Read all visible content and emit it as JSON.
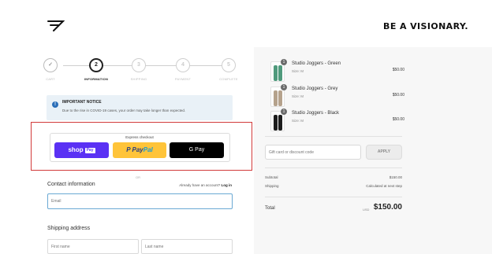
{
  "brand": {
    "logo_icon": "gymshark-logo-icon",
    "tagline": "BE A VISIONARY."
  },
  "progress": {
    "steps": [
      {
        "number": "✓",
        "label": "CART",
        "state": "done"
      },
      {
        "number": "2",
        "label": "INFORMATION",
        "state": "active"
      },
      {
        "number": "3",
        "label": "SHIPPING",
        "state": "pending"
      },
      {
        "number": "4",
        "label": "PAYMENT",
        "state": "pending"
      },
      {
        "number": "5",
        "label": "COMPLETE",
        "state": "pending"
      }
    ]
  },
  "notice": {
    "icon": "info-icon",
    "title": "IMPORTANT NOTICE",
    "text": "Due to the rise in COVID-19 cases, your order may take longer than expected."
  },
  "express": {
    "title": "Express checkout",
    "shop_pay": {
      "label": "shop",
      "badge": "Pay"
    },
    "paypal": {
      "pay": "P Pay",
      "pal": "Pal"
    },
    "gpay": {
      "label": "G Pay"
    }
  },
  "divider_or": "OR",
  "contact": {
    "title": "Contact information",
    "have_account": "Already have an account?",
    "login": "Log in",
    "email_placeholder": "Email"
  },
  "shipping": {
    "title": "Shipping address",
    "first_name_placeholder": "First name",
    "last_name_placeholder": "Last name"
  },
  "cart": {
    "items": [
      {
        "name": "Studio Joggers - Green",
        "size": "Size: M",
        "price": "$50.00",
        "qty": "1",
        "color": "#4f9a7c"
      },
      {
        "name": "Studio Joggers - Grey",
        "size": "Size: M",
        "price": "$50.00",
        "qty": "1",
        "color": "#b5a28c"
      },
      {
        "name": "Studio Joggers - Black",
        "size": "Size: M",
        "price": "$50.00",
        "qty": "1",
        "color": "#1d1d1d"
      }
    ],
    "discount_placeholder": "Gift card or discount code",
    "apply_label": "APPLY",
    "subtotal_label": "Subtotal",
    "subtotal_value": "$150.00",
    "shipping_label": "Shipping",
    "shipping_value": "Calculated at next step",
    "total_label": "Total",
    "total_currency": "USD",
    "total_value": "$150.00"
  },
  "colors": {
    "highlight_border": "#d23a3a",
    "shop_pay": "#5a31f4",
    "paypal": "#ffc439",
    "gpay": "#000000",
    "notice_bg": "#e9f1f7",
    "notice_icon": "#2a6eb8"
  }
}
